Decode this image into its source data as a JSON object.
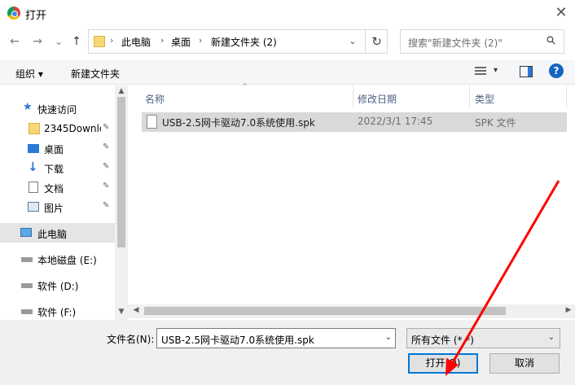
{
  "window": {
    "title": "打开",
    "close_glyph": "✕"
  },
  "nav": {
    "back": "←",
    "forward": "→",
    "recent": "⌄",
    "up": "↑",
    "breadcrumb": [
      "此电脑",
      "桌面",
      "新建文件夹 (2)"
    ],
    "separator": "›",
    "dropdown": "⌄",
    "refresh": "↻"
  },
  "search": {
    "placeholder": "搜索\"新建文件夹 (2)\"",
    "icon": "⚲"
  },
  "toolbar": {
    "organize": "组织 ▾",
    "new_folder": "新建文件夹",
    "view_dd": "▾",
    "help": "?"
  },
  "sidebar": {
    "items": [
      {
        "label": "快速访问",
        "icon": "star-icon"
      },
      {
        "label": "2345Downlc",
        "icon": "folder-icon",
        "pinned": true
      },
      {
        "label": "桌面",
        "icon": "desktop-icon",
        "pinned": true
      },
      {
        "label": "下载",
        "icon": "download-icon",
        "pinned": true
      },
      {
        "label": "文档",
        "icon": "document-icon",
        "pinned": true
      },
      {
        "label": "图片",
        "icon": "picture-icon",
        "pinned": true
      },
      {
        "label": "此电脑",
        "icon": "computer-icon",
        "selected": true
      },
      {
        "label": "本地磁盘 (E:)",
        "icon": "drive-icon"
      },
      {
        "label": "软件 (D:)",
        "icon": "drive-icon"
      },
      {
        "label": "软件 (F:)",
        "icon": "drive-icon"
      }
    ],
    "pin_glyph": "📌"
  },
  "filelist": {
    "columns": [
      "名称",
      "修改日期",
      "类型"
    ],
    "sort_glyph": "⌃",
    "rows": [
      {
        "name": "USB-2.5网卡驱动7.0系统使用.spk",
        "date": "2022/3/1 17:45",
        "type": "SPK 文件"
      }
    ]
  },
  "footer": {
    "filename_label": "文件名(N):",
    "filename_value": "USB-2.5网卡驱动7.0系统使用.spk",
    "filetype_value": "所有文件 (*.*)",
    "open_label": "打开(O)",
    "cancel_label": "取消",
    "dropdown": "⌄"
  },
  "colors": {
    "selection": "#d9d9d9",
    "nav_selected": "#cce8ff",
    "accent": "#0078d7",
    "annotation": "#ff0000"
  }
}
